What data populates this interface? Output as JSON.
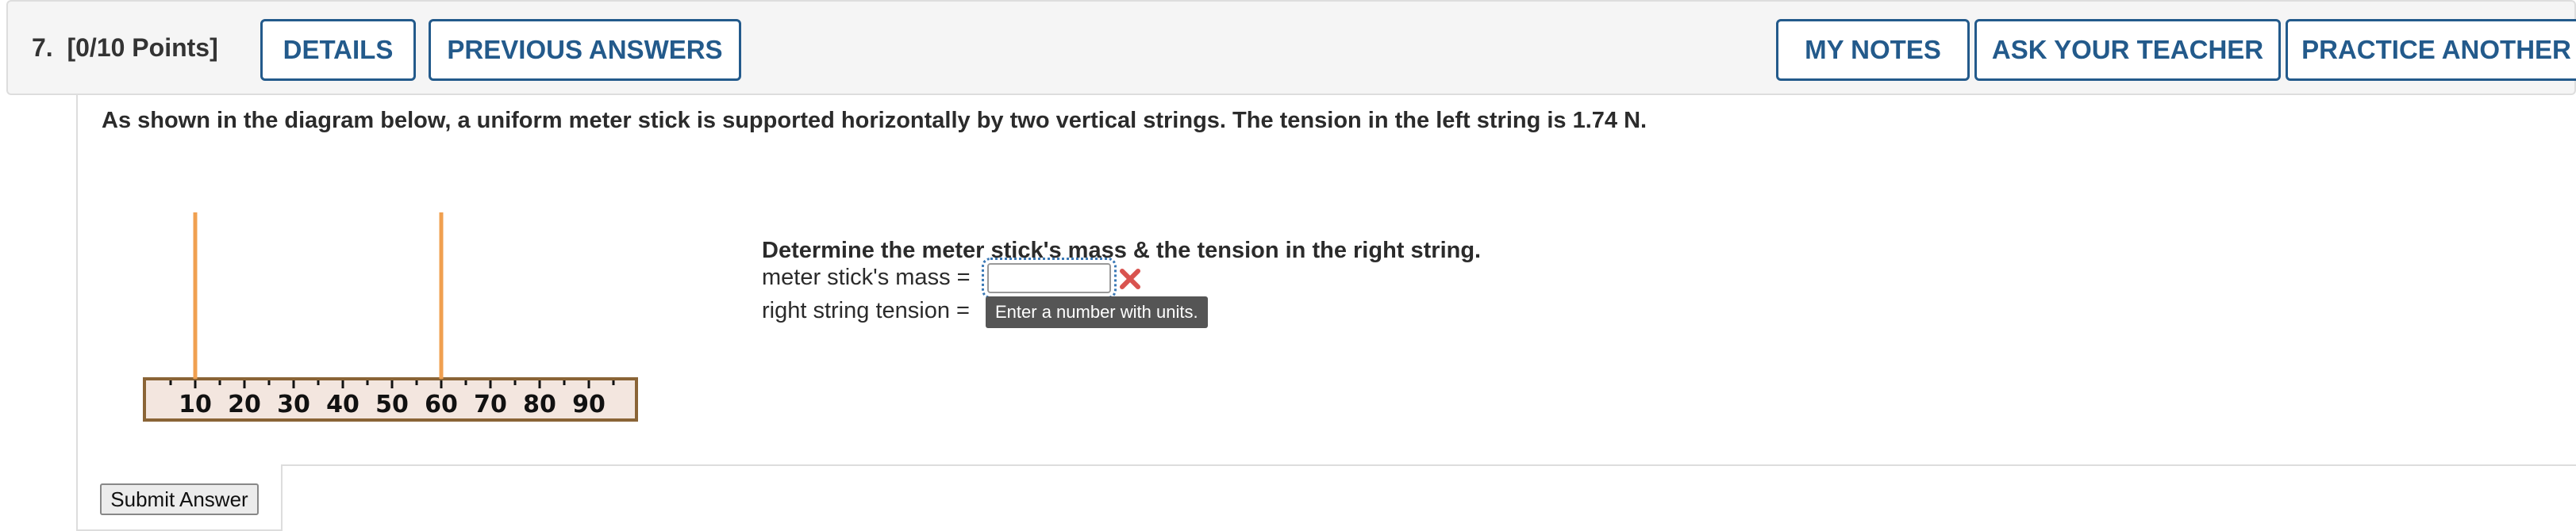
{
  "header": {
    "question_number": "7.",
    "points": "[0/10 Points]",
    "buttons": {
      "details": "DETAILS",
      "previous_answers": "PREVIOUS ANSWERS",
      "my_notes": "MY NOTES",
      "ask_teacher": "ASK YOUR TEACHER",
      "practice_another": "PRACTICE ANOTHER"
    }
  },
  "question": {
    "text": "As shown in the diagram below, a uniform meter stick is supported horizontally by two vertical strings. The tension in the left string is 1.74 N.",
    "prompt": "Determine the meter stick's mass & the tension in the right string."
  },
  "diagram": {
    "scale_labels": [
      "10",
      "20",
      "30",
      "40",
      "50",
      "60",
      "70",
      "80",
      "90"
    ],
    "string_positions_cm": [
      10,
      60
    ],
    "colors": {
      "string": "#f0a050",
      "stick_fill": "#f3e6df",
      "stick_border": "#8a6436"
    }
  },
  "answers": {
    "mass_label": "meter stick's mass =",
    "mass_value": "",
    "tension_label": "right string tension =",
    "tension_value": "",
    "tooltip": "Enter a number with units."
  },
  "submit": {
    "label": "Submit Answer"
  },
  "colors": {
    "accent": "#235a8b",
    "error": "#d9534f"
  }
}
